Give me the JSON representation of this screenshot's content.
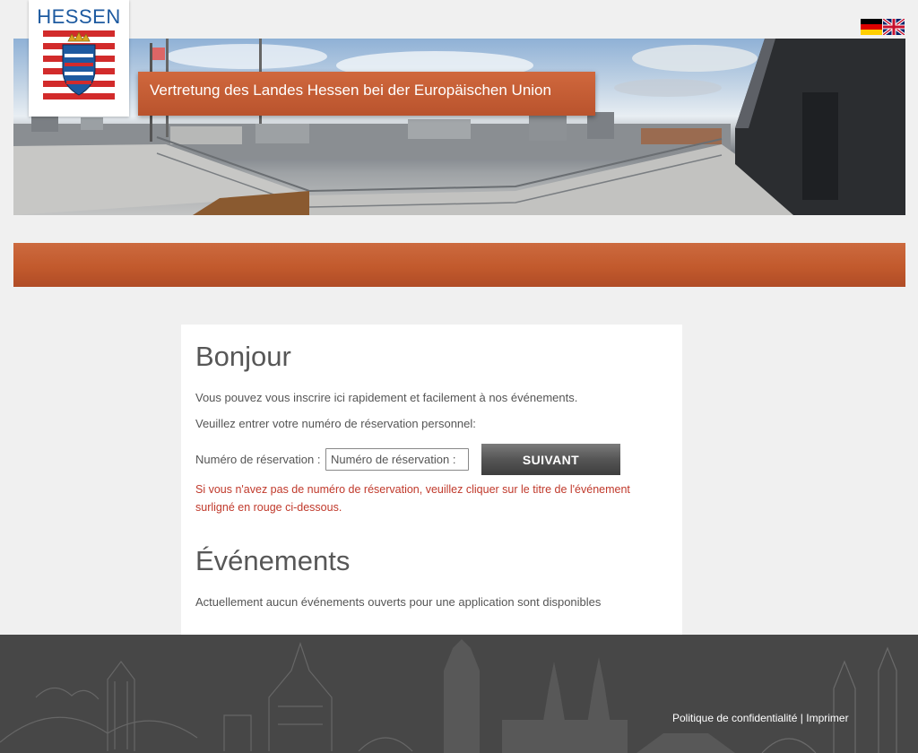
{
  "header": {
    "logo_text": "HESSEN",
    "title": "Vertretung des Landes Hessen bei der Europäischen Union",
    "flags": [
      {
        "name": "german-flag",
        "lang": "Deutsch"
      },
      {
        "name": "english-flag",
        "lang": "English"
      }
    ]
  },
  "card": {
    "greeting": "Bonjour",
    "intro": "Vous pouvez vous inscrire ici rapidement et facilement à nos événements.",
    "instruction": "Veuillez entrer votre numéro de réservation personnel:",
    "reservation_label": "Numéro de réservation :",
    "reservation_placeholder": "Numéro de réservation :",
    "reservation_value": "",
    "next_button": "SUIVANT",
    "warning": "Si vous n'avez pas de numéro de réservation, veuillez cliquer sur le titre de l'événement surligné en rouge ci-dessous.",
    "events_title": "Événements",
    "events_empty": "Actuellement aucun événements ouverts pour une application sont disponibles"
  },
  "footer": {
    "privacy": "Politique de confidentialité",
    "separator": " | ",
    "imprint": "Imprimer"
  },
  "colors": {
    "accent": "#c25a2d",
    "warning": "#c0392b",
    "footer": "#474747",
    "logo_blue": "#1d5aa0",
    "logo_red": "#d22b2b"
  }
}
